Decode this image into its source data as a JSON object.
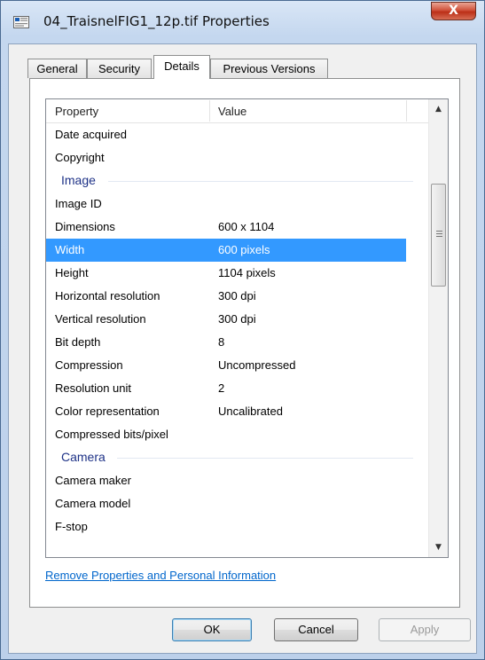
{
  "window": {
    "title": "04_TraisnelFIG1_12p.tif Properties",
    "close_glyph": "X"
  },
  "tabs": [
    {
      "label": "General"
    },
    {
      "label": "Security"
    },
    {
      "label": "Details",
      "active": true
    },
    {
      "label": "Previous Versions"
    }
  ],
  "details": {
    "columns": {
      "property": "Property",
      "value": "Value"
    },
    "rows": [
      {
        "kind": "row",
        "property": "Date acquired",
        "value": ""
      },
      {
        "kind": "row",
        "property": "Copyright",
        "value": ""
      },
      {
        "kind": "group",
        "label": "Image"
      },
      {
        "kind": "row",
        "property": "Image ID",
        "value": ""
      },
      {
        "kind": "row",
        "property": "Dimensions",
        "value": "600 x 1104"
      },
      {
        "kind": "row",
        "property": "Width",
        "value": "600 pixels",
        "selected": true
      },
      {
        "kind": "row",
        "property": "Height",
        "value": "1104 pixels"
      },
      {
        "kind": "row",
        "property": "Horizontal resolution",
        "value": "300 dpi"
      },
      {
        "kind": "row",
        "property": "Vertical resolution",
        "value": "300 dpi"
      },
      {
        "kind": "row",
        "property": "Bit depth",
        "value": "8"
      },
      {
        "kind": "row",
        "property": "Compression",
        "value": "Uncompressed"
      },
      {
        "kind": "row",
        "property": "Resolution unit",
        "value": "2"
      },
      {
        "kind": "row",
        "property": "Color representation",
        "value": "Uncalibrated"
      },
      {
        "kind": "row",
        "property": "Compressed bits/pixel",
        "value": ""
      },
      {
        "kind": "group",
        "label": "Camera"
      },
      {
        "kind": "row",
        "property": "Camera maker",
        "value": ""
      },
      {
        "kind": "row",
        "property": "Camera model",
        "value": ""
      },
      {
        "kind": "row",
        "property": "F-stop",
        "value": ""
      }
    ]
  },
  "link": {
    "label": "Remove Properties and Personal Information"
  },
  "buttons": {
    "ok": "OK",
    "cancel": "Cancel",
    "apply": "Apply"
  },
  "icons": {
    "title": "tif-file-icon",
    "scroll_up": "up-arrow-icon",
    "scroll_down": "down-arrow-icon",
    "scroll_grip": "grip-icon"
  },
  "colors": {
    "selection": "#3399ff",
    "group_header": "#1e3287",
    "link": "#0066cc",
    "close_button": "#c8452e"
  }
}
